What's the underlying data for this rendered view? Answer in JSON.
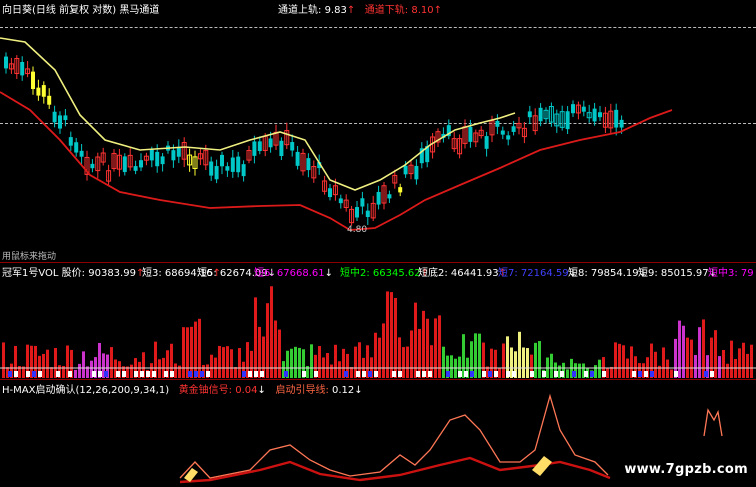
{
  "top": {
    "period_label": "向日葵(日线 前复权 对数) 黑马通道",
    "upper_label": "通道上轨:",
    "upper_value": "9.83",
    "upper_arrow": "↑",
    "lower_label": "通道下轨:",
    "lower_value": "8.10",
    "lower_arrow": "↑",
    "low_price": "4.80",
    "cursor_hint": "用鼠标来拖动"
  },
  "vol_panel": {
    "title": "冠军1号VOL",
    "stock_label": "股价:",
    "stock_value": "90383.99",
    "stock_arrow": "↑",
    "items": [
      {
        "label": "短3:",
        "value": "68694.16",
        "arrow": "↑",
        "color": "#ffffff"
      },
      {
        "label": "短5:",
        "value": "62674.09",
        "arrow": "↓",
        "color": "#ffffff"
      },
      {
        "label": "短6:",
        "value": "67668.61",
        "arrow": "↓",
        "color": "#ff00ff"
      },
      {
        "label": "短中2:",
        "value": "66345.62",
        "arrow": "↑",
        "color": "#00ff00"
      },
      {
        "label": "短底2:",
        "value": "46441.93",
        "arrow": "↑",
        "color": "#ffffff"
      },
      {
        "label": "短7:",
        "value": "72164.59",
        "arrow": "↓",
        "color": "#4040ff"
      },
      {
        "label": "短8:",
        "value": "79854.19",
        "arrow": "↓",
        "color": "#ffffff"
      },
      {
        "label": "短9:",
        "value": "85015.97",
        "arrow": "↓",
        "color": "#ffffff"
      },
      {
        "label": "短中3:",
        "value": "79",
        "arrow": "",
        "color": "#ff00ff"
      }
    ]
  },
  "hmax_panel": {
    "title": "H-MAX启动确认(12,26,200,9,34,1)",
    "signal_label": "黄金铀信号:",
    "signal_value": "0.04",
    "signal_arrow": "↓",
    "guide_label": "启动引导线:",
    "guide_value": "0.12",
    "guide_arrow": "↓"
  },
  "watermark": "www.7gpzb.com",
  "colors": {
    "background": "#000000",
    "up_candle": "#ff3333",
    "down_candle": "#00c8c8",
    "upper_channel": "#f0f080",
    "lower_channel": "#dd1a1a",
    "panel_border": "#8b0000",
    "vol_red": "#e01a1a",
    "vol_green": "#33cc33",
    "vol_yellow": "#f0f080",
    "vol_magenta": "#cc33cc",
    "vol_blue": "#3333ff",
    "hmax_line": "#ff6644"
  }
}
